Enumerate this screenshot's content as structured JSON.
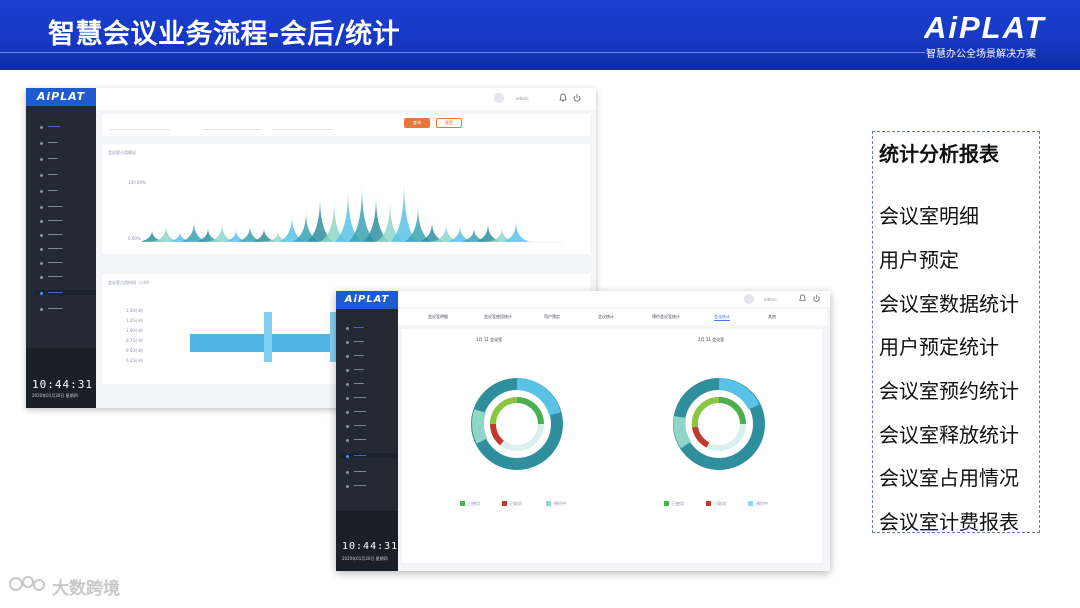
{
  "banner": {
    "title": "智慧会议业务流程-会后/统计",
    "logo": "AiPLAT",
    "tagline": "智慧办公全场景解决方案"
  },
  "shot1": {
    "sidebar_logo": "AiPLAT",
    "clock": "10:44:31",
    "clock_date": "2020年01月30日 星期四",
    "user": "admin",
    "btn_query": "查询",
    "btn_reset": "重置",
    "chart_title": "会议室占用情况",
    "chart_ylabels": [
      "100.00%",
      "0.00%"
    ],
    "bar_title": "会议室占用时间（小时）",
    "bar_ylabels": [
      "1.50小时",
      "1.25小时",
      "1.00小时",
      "0.75小时",
      "0.50小时",
      "0.25小时"
    ]
  },
  "shot2": {
    "sidebar_logo": "AiPLAT",
    "clock": "10:44:31",
    "clock_date": "2020年01月30日 星期四",
    "user": "admin",
    "tabs": [
      "会议室明细",
      "会议室使用统计",
      "用户预定",
      "会议统计",
      "预约会议室统计",
      "会议统计",
      "其他"
    ],
    "donut_left_title": "1月  11 会议室",
    "donut_right_title": "2月  11 会议室",
    "legend_left": [
      "已使用",
      "已取消",
      "预约中"
    ],
    "legend_right": [
      "已使用",
      "已取消",
      "预约中"
    ]
  },
  "list": {
    "heading": "统计分析报表",
    "items": [
      "会议室明细",
      "用户预定",
      "会议室数据统计",
      "用户预定统计",
      "会议室预约统计",
      "会议室释放统计",
      "会议室占用情况",
      "会议室计费报表"
    ]
  },
  "watermark": "大数跨境",
  "colors": {
    "banner": "#1638c4",
    "teal": "#2f8f9d",
    "mint": "#8fd6c8",
    "sky": "#5bc2e7",
    "orange": "#e7773a"
  }
}
